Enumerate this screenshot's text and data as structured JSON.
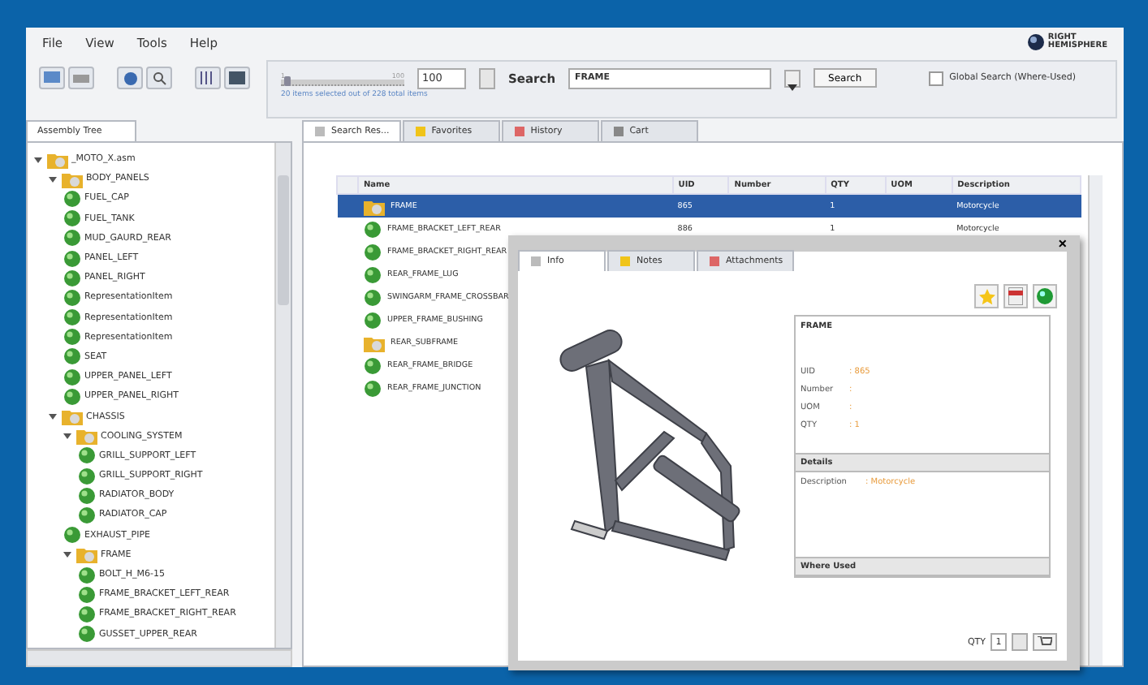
{
  "menu": [
    "File",
    "View",
    "Tools",
    "Help"
  ],
  "logo": {
    "line1": "RIGHT",
    "line2": "HEMISPHERE"
  },
  "toolbar": {
    "slider_min": "1",
    "slider_max": "100",
    "level": 0.05,
    "slider_value": "100",
    "selection_info": "20 items selected out of 228 total items",
    "search_label": "Search",
    "search_value": "FRAME",
    "search_button": "Search",
    "global_search": {
      "label": "Global Search (Where-Used)",
      "checked": false
    }
  },
  "tree_tab": "Assembly Tree",
  "tree": [
    {
      "label": "_MOTO_X.asm",
      "kind": "assembly",
      "expanded": true,
      "children": [
        {
          "label": "BODY_PANELS",
          "kind": "assembly",
          "expanded": true,
          "children": [
            {
              "label": "FUEL_CAP",
              "kind": "part"
            },
            {
              "label": "FUEL_TANK",
              "kind": "part"
            },
            {
              "label": "MUD_GAURD_REAR",
              "kind": "part"
            },
            {
              "label": "PANEL_LEFT",
              "kind": "part"
            },
            {
              "label": "PANEL_RIGHT",
              "kind": "part"
            },
            {
              "label": "RepresentationItem",
              "kind": "part"
            },
            {
              "label": "RepresentationItem",
              "kind": "part"
            },
            {
              "label": "RepresentationItem",
              "kind": "part"
            },
            {
              "label": "SEAT",
              "kind": "part"
            },
            {
              "label": "UPPER_PANEL_LEFT",
              "kind": "part"
            },
            {
              "label": "UPPER_PANEL_RIGHT",
              "kind": "part"
            }
          ]
        },
        {
          "label": "CHASSIS",
          "kind": "assembly",
          "expanded": true,
          "children": [
            {
              "label": "COOLING_SYSTEM",
              "kind": "assembly",
              "expanded": true,
              "children": [
                {
                  "label": "GRILL_SUPPORT_LEFT",
                  "kind": "part"
                },
                {
                  "label": "GRILL_SUPPORT_RIGHT",
                  "kind": "part"
                },
                {
                  "label": "RADIATOR_BODY",
                  "kind": "part"
                },
                {
                  "label": "RADIATOR_CAP",
                  "kind": "part"
                }
              ]
            },
            {
              "label": "EXHAUST_PIPE",
              "kind": "part"
            },
            {
              "label": "FRAME",
              "kind": "assembly",
              "expanded": true,
              "children": [
                {
                  "label": "BOLT_H_M6-15",
                  "kind": "part"
                },
                {
                  "label": "FRAME_BRACKET_LEFT_REAR",
                  "kind": "part"
                },
                {
                  "label": "FRAME_BRACKET_RIGHT_REAR",
                  "kind": "part"
                },
                {
                  "label": "GUSSET_UPPER_REAR",
                  "kind": "part"
                }
              ]
            }
          ]
        }
      ]
    }
  ],
  "result_tabs": [
    {
      "label": "Search Res...",
      "selected": true
    },
    {
      "label": "Favorites",
      "selected": false
    },
    {
      "label": "History",
      "selected": false
    },
    {
      "label": "Cart",
      "selected": false
    }
  ],
  "table": {
    "columns": [
      "Name",
      "UID",
      "Number",
      "QTY",
      "UOM",
      "Description"
    ],
    "rows": [
      {
        "kind": "assembly",
        "selected": true,
        "cells": [
          "FRAME",
          "865",
          "",
          "1",
          "",
          "Motorcycle"
        ]
      },
      {
        "kind": "part",
        "selected": false,
        "cells": [
          "FRAME_BRACKET_LEFT_REAR",
          "886",
          "",
          "1",
          "",
          "Motorcycle"
        ]
      },
      {
        "kind": "part",
        "selected": false,
        "cells": [
          "FRAME_BRACKET_RIGHT_REAR"
        ]
      },
      {
        "kind": "part",
        "selected": false,
        "cells": [
          "REAR_FRAME_LUG"
        ]
      },
      {
        "kind": "part",
        "selected": false,
        "cells": [
          "SWINGARM_FRAME_CROSSBAR"
        ]
      },
      {
        "kind": "part",
        "selected": false,
        "cells": [
          "UPPER_FRAME_BUSHING"
        ]
      },
      {
        "kind": "assembly",
        "selected": false,
        "cells": [
          "REAR_SUBFRAME"
        ]
      },
      {
        "kind": "part",
        "selected": false,
        "cells": [
          "REAR_FRAME_BRIDGE"
        ]
      },
      {
        "kind": "part",
        "selected": false,
        "cells": [
          "REAR_FRAME_JUNCTION"
        ]
      }
    ]
  },
  "popup": {
    "close": "×",
    "tabs": [
      {
        "label": "Info",
        "selected": true
      },
      {
        "label": "Notes",
        "selected": false
      },
      {
        "label": "Attachments",
        "selected": false
      }
    ],
    "title": "FRAME",
    "fields": [
      {
        "label": "UID",
        "value": ": 865"
      },
      {
        "label": "Number",
        "value": ":"
      },
      {
        "label": "UOM",
        "value": ":"
      },
      {
        "label": "QTY",
        "value": ": 1"
      }
    ],
    "details_header": "Details",
    "details": [
      {
        "label": "Description",
        "value": ": Motorcycle"
      }
    ],
    "where_used_header": "Where Used",
    "qty_label": "QTY",
    "qty_value": "1"
  }
}
